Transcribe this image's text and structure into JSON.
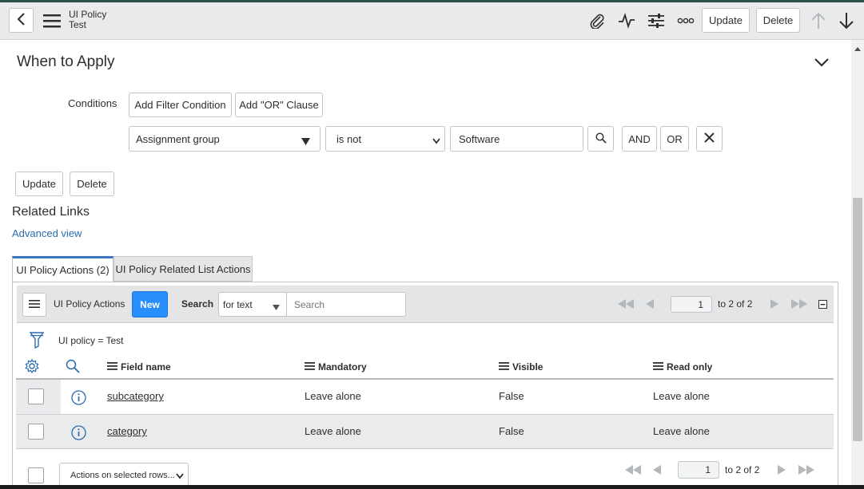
{
  "header": {
    "title": "UI Policy",
    "subtitle": "Test",
    "update_label": "Update",
    "delete_label": "Delete"
  },
  "section": {
    "title": "When to Apply",
    "conditions_label": "Conditions",
    "add_filter_label": "Add Filter Condition",
    "add_or_label": "Add \"OR\" Clause",
    "field_value": "Assignment group",
    "operator_value": "is not",
    "condition_value": "Software",
    "and_label": "AND",
    "or_label": "OR"
  },
  "form_actions": {
    "update_label": "Update",
    "delete_label": "Delete"
  },
  "related_links": {
    "title": "Related Links",
    "advanced_view": "Advanced view"
  },
  "tabs": [
    {
      "label": "UI Policy Actions (2)"
    },
    {
      "label": "UI Policy Related List Actions"
    }
  ],
  "list": {
    "title": "UI Policy Actions",
    "new_label": "New",
    "search_label": "Search",
    "search_field_value": "for text",
    "search_placeholder": "Search",
    "page_value": "1",
    "page_range": "to 2 of 2",
    "filter_text": "UI policy = Test",
    "columns": [
      "Field name",
      "Mandatory",
      "Visible",
      "Read only"
    ],
    "rows": [
      {
        "field_name": "subcategory",
        "mandatory": "Leave alone",
        "visible": "False",
        "read_only": "Leave alone"
      },
      {
        "field_name": "category",
        "mandatory": "Leave alone",
        "visible": "False",
        "read_only": "Leave alone"
      }
    ],
    "actions_select": "Actions on selected rows...",
    "bottom_page_value": "1",
    "bottom_page_range": "to 2 of 2"
  },
  "colors": {
    "accent": "#278efc",
    "link": "#2b6cb0",
    "header_bg": "#e9eaeb"
  }
}
